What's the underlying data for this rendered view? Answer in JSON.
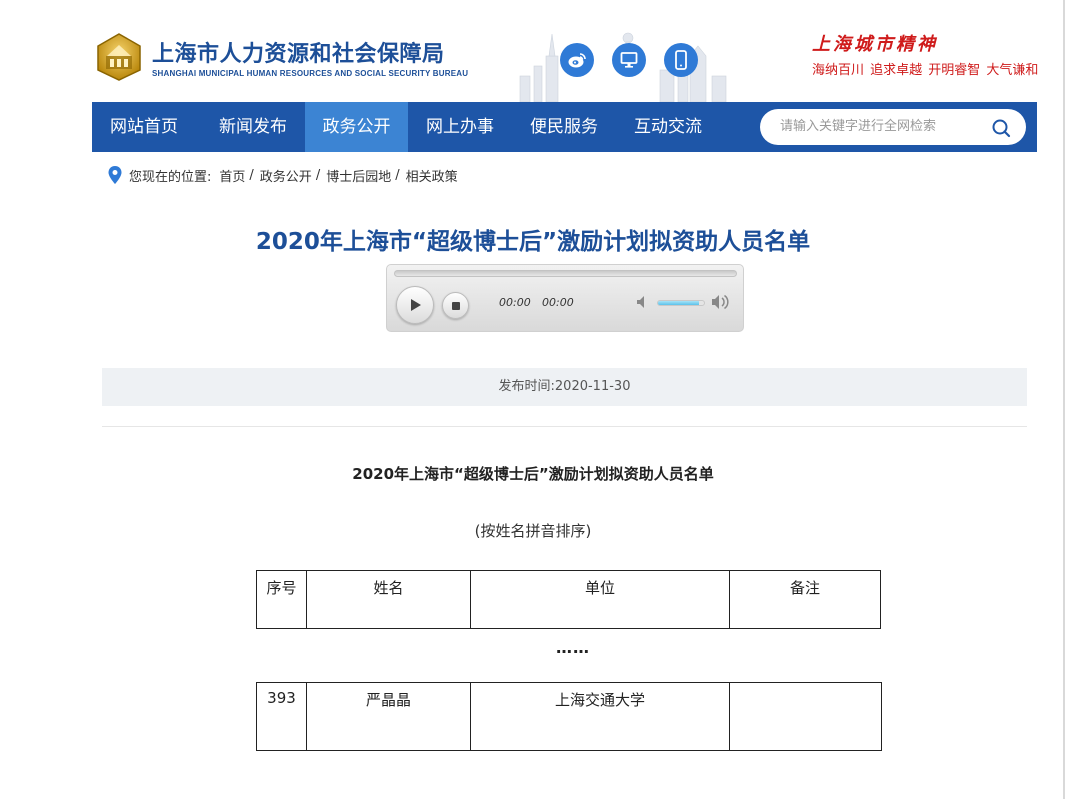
{
  "header": {
    "title": "上海市人力资源和社会保障局",
    "subtitle": "SHANGHAI MUNICIPAL HUMAN RESOURCES AND SOCIAL SECURITY BUREAU",
    "social_icons": [
      "weibo-icon",
      "desktop-icon",
      "mobile-icon"
    ],
    "spirit_title": "上海城市精神",
    "spirit_slogan": "海纳百川  追求卓越  开明睿智  大气谦和"
  },
  "nav": {
    "items": [
      {
        "label": "网站首页"
      },
      {
        "label": "新闻发布"
      },
      {
        "label": "政务公开",
        "active": true
      },
      {
        "label": "网上办事"
      },
      {
        "label": "便民服务"
      },
      {
        "label": "互动交流"
      }
    ],
    "search_placeholder": "请输入关键字进行全网检索"
  },
  "breadcrumb": {
    "prefix": "您现在的位置:",
    "items": [
      "首页",
      "政务公开",
      "博士后园地",
      "相关政策"
    ]
  },
  "article": {
    "title": "2020年上海市“超级博士后”激励计划拟资助人员名单",
    "publish_time": "发布时间:2020-11-30",
    "doc_title": "2020年上海市“超级博士后”激励计划拟资助人员名单",
    "doc_note": "(按姓名拼音排序)",
    "ellipsis": "……"
  },
  "player": {
    "current_time": "00:00",
    "duration": "00:00",
    "volume": 0.9
  },
  "table": {
    "headers": [
      "序号",
      "姓名",
      "单位",
      "备注"
    ],
    "rows": [
      [
        "393",
        "严晶晶",
        "上海交通大学",
        ""
      ]
    ]
  },
  "colors": {
    "brand_blue": "#1e56a8",
    "nav_active": "#3c84d3",
    "title_blue": "#1d4f98",
    "spirit_red": "#cf1b1b"
  }
}
